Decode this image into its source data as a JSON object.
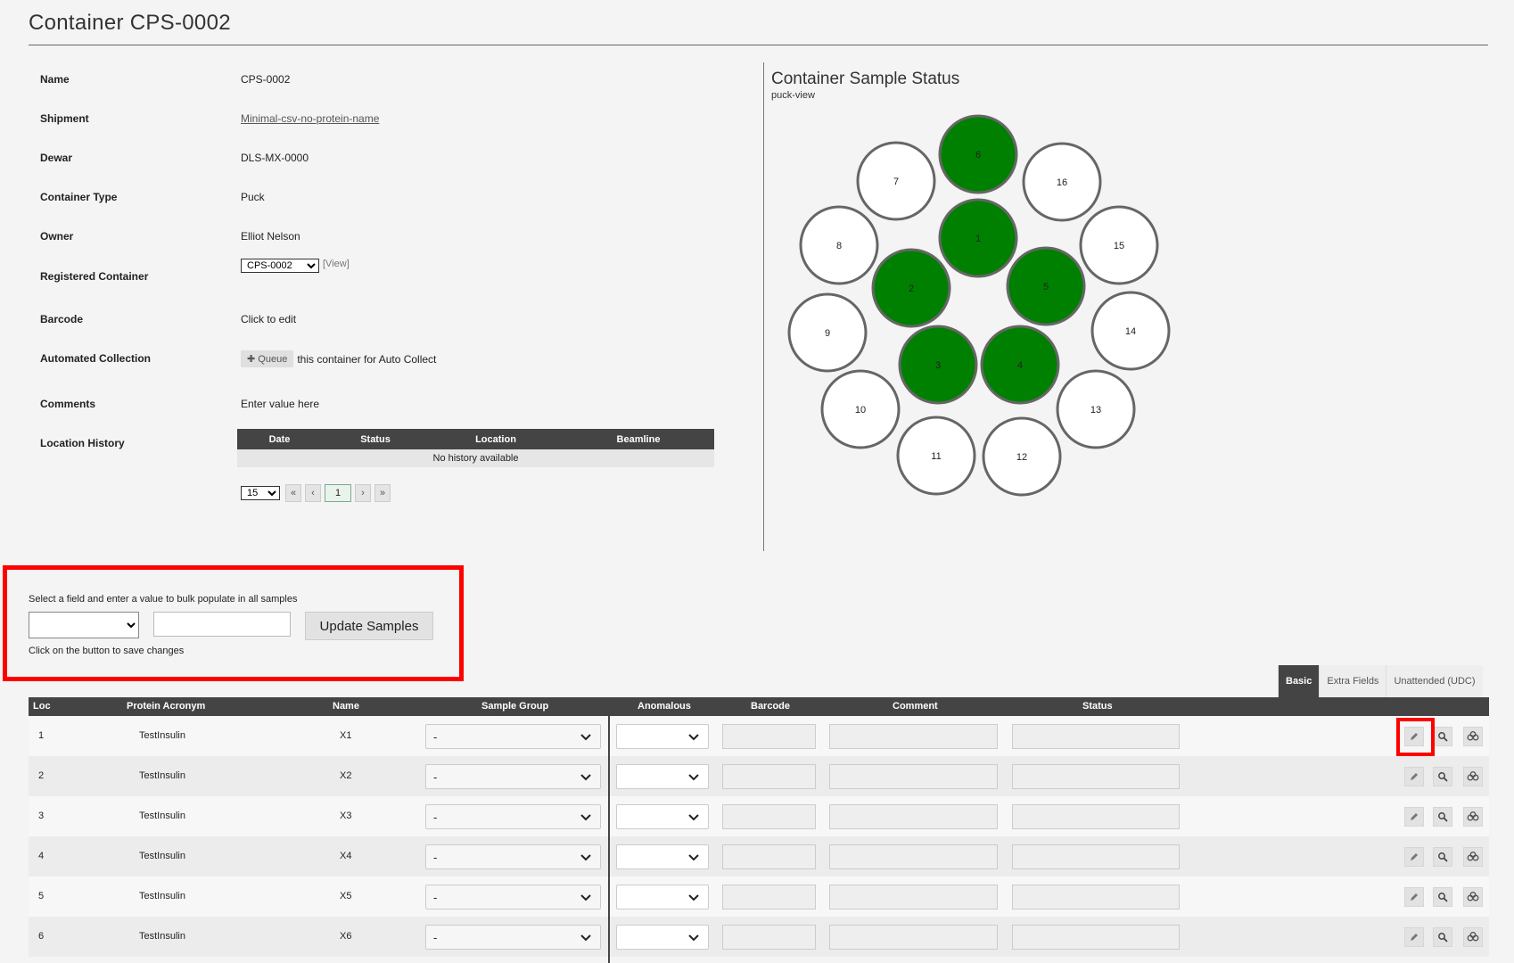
{
  "page": {
    "title": "Container CPS-0002"
  },
  "details": {
    "name_label": "Name",
    "name_value": "CPS-0002",
    "shipment_label": "Shipment",
    "shipment_value": "Minimal-csv-no-protein-name",
    "dewar_label": "Dewar",
    "dewar_value": "DLS-MX-0000",
    "type_label": "Container Type",
    "type_value": "Puck",
    "owner_label": "Owner",
    "owner_value": "Elliot Nelson",
    "registered_label": "Registered Container",
    "registered_value": "CPS-0002",
    "registered_view": "[View]",
    "barcode_label": "Barcode",
    "barcode_value": "Click to edit",
    "auto_label": "Automated Collection",
    "auto_queue": "Queue",
    "auto_text": "this container for Auto Collect",
    "comments_label": "Comments",
    "comments_value": "Enter value here",
    "history_label": "Location History"
  },
  "history": {
    "columns": [
      "Date",
      "Status",
      "Location",
      "Beamline"
    ],
    "empty": "No history available",
    "page_size": "15",
    "first": "«",
    "prev": "‹",
    "current_page": "1",
    "next": "›",
    "last": "»"
  },
  "status_panel": {
    "title": "Container Sample Status",
    "subtitle": "puck-view",
    "filled_color": "#008000",
    "empty_color": "#ffffff",
    "positions": [
      {
        "label": "1",
        "filled": true
      },
      {
        "label": "2",
        "filled": true
      },
      {
        "label": "3",
        "filled": true
      },
      {
        "label": "4",
        "filled": true
      },
      {
        "label": "5",
        "filled": true
      },
      {
        "label": "6",
        "filled": true
      },
      {
        "label": "7",
        "filled": false
      },
      {
        "label": "8",
        "filled": false
      },
      {
        "label": "9",
        "filled": false
      },
      {
        "label": "10",
        "filled": false
      },
      {
        "label": "11",
        "filled": false
      },
      {
        "label": "12",
        "filled": false
      },
      {
        "label": "13",
        "filled": false
      },
      {
        "label": "14",
        "filled": false
      },
      {
        "label": "15",
        "filled": false
      },
      {
        "label": "16",
        "filled": false
      }
    ]
  },
  "bulk": {
    "instruction": "Select a field and enter a value to bulk populate in all samples",
    "button": "Update Samples",
    "hint": "Click on the button to save changes"
  },
  "tabs": [
    "Basic",
    "Extra Fields",
    "Unattended (UDC)"
  ],
  "samples": {
    "columns": [
      "Loc",
      "Protein Acronym",
      "Name",
      "Sample Group",
      "Anomalous",
      "Barcode",
      "Comment",
      "Status"
    ],
    "rows": [
      {
        "loc": "1",
        "protein": "TestInsulin",
        "name": "X1",
        "group": "-"
      },
      {
        "loc": "2",
        "protein": "TestInsulin",
        "name": "X2",
        "group": "-"
      },
      {
        "loc": "3",
        "protein": "TestInsulin",
        "name": "X3",
        "group": "-"
      },
      {
        "loc": "4",
        "protein": "TestInsulin",
        "name": "X4",
        "group": "-"
      },
      {
        "loc": "5",
        "protein": "TestInsulin",
        "name": "X5",
        "group": "-"
      },
      {
        "loc": "6",
        "protein": "TestInsulin",
        "name": "X6",
        "group": "-"
      }
    ]
  },
  "highlight_color": "#ff0000"
}
